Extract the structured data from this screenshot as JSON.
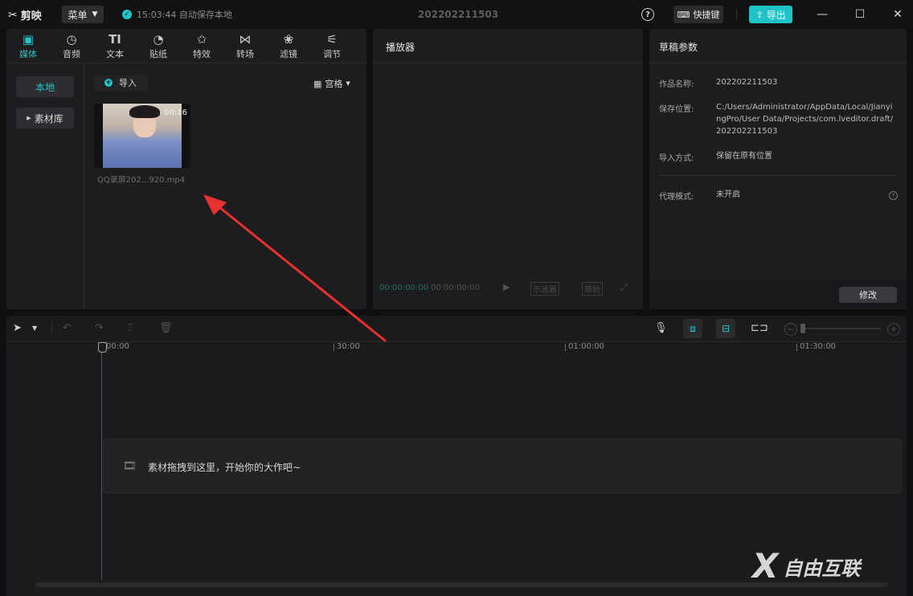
{
  "app": {
    "name": "剪映",
    "menu_label": "菜单",
    "autosave_text": "15:03:44 自动保存本地",
    "project_title": "202202211503",
    "shortcut_label": "快捷键",
    "export_label": "导出"
  },
  "media": {
    "tabs": [
      {
        "label": "媒体",
        "icon": "media-icon"
      },
      {
        "label": "音频",
        "icon": "audio-icon"
      },
      {
        "label": "文本",
        "icon": "text-icon"
      },
      {
        "label": "贴纸",
        "icon": "sticker-icon"
      },
      {
        "label": "特效",
        "icon": "effects-icon"
      },
      {
        "label": "转场",
        "icon": "transition-icon"
      },
      {
        "label": "滤镜",
        "icon": "filter-icon"
      },
      {
        "label": "调节",
        "icon": "adjust-icon"
      }
    ],
    "local_label": "本地",
    "library_label": "素材库",
    "import_label": "导入",
    "view_label": "宫格",
    "clip": {
      "duration": "00:16",
      "filename": "QQ录屏202...920.mp4"
    }
  },
  "player": {
    "title": "播放器",
    "current_time": "00:00:00:00",
    "total_time": "00:00:00:00",
    "scope_label": "示波器",
    "ratio_label": "原始"
  },
  "params": {
    "title": "草稿参数",
    "rows": [
      {
        "label": "作品名称:",
        "value": "202202211503"
      },
      {
        "label": "保存位置:",
        "value": "C:/Users/Administrator/AppData/Local/JianyingPro/User Data/Projects/com.lveditor.draft/202202211503"
      },
      {
        "label": "导入方式:",
        "value": "保留在原有位置"
      },
      {
        "label": "代理模式:",
        "value": "未开启"
      }
    ],
    "edit_label": "修改"
  },
  "timeline": {
    "ruler_labels": [
      "00:00",
      "30:00",
      "01:00:00",
      "01:30:00"
    ],
    "drop_hint": "素材拖拽到这里，开始你的大作吧~"
  },
  "watermark": {
    "text": "自由互联"
  },
  "colors": {
    "accent": "#21c5c7",
    "arrow": "#e8302f",
    "panel": "#1d1d1f",
    "background": "#0f0f10"
  }
}
